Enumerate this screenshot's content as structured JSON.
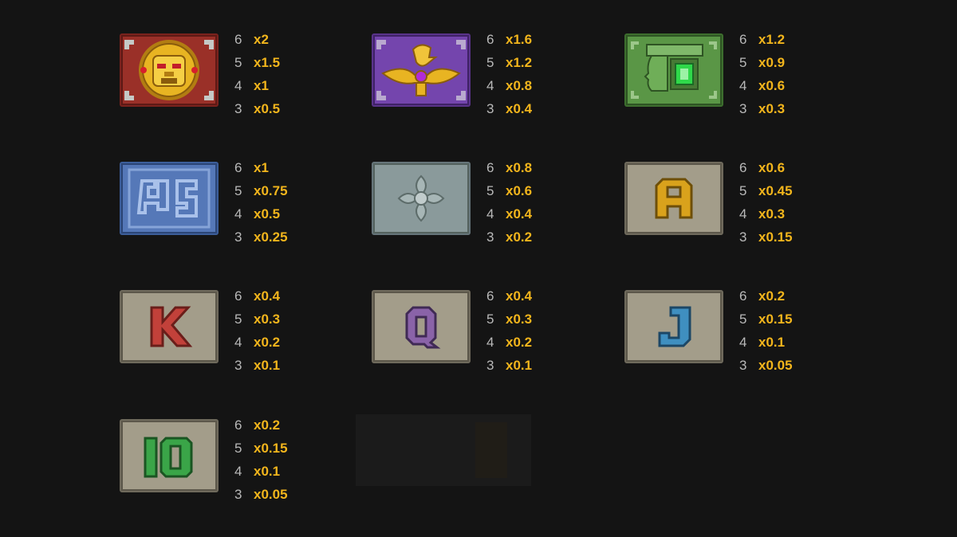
{
  "paytable": {
    "symbols": [
      {
        "name": "golden-sun-mask",
        "colors": {
          "bg": "#8e2a22",
          "accent": "#e8b422"
        },
        "pays": [
          {
            "count": "6",
            "mult": "x2"
          },
          {
            "count": "5",
            "mult": "x1.5"
          },
          {
            "count": "4",
            "mult": "x1"
          },
          {
            "count": "3",
            "mult": "x0.5"
          }
        ]
      },
      {
        "name": "golden-eagle",
        "colors": {
          "bg": "#6a3e9e",
          "accent": "#e8b422"
        },
        "pays": [
          {
            "count": "6",
            "mult": "x1.6"
          },
          {
            "count": "5",
            "mult": "x1.2"
          },
          {
            "count": "4",
            "mult": "x0.8"
          },
          {
            "count": "3",
            "mult": "x0.4"
          }
        ]
      },
      {
        "name": "jade-head",
        "colors": {
          "bg": "#4f8a3c",
          "accent": "#2fd84a"
        },
        "pays": [
          {
            "count": "6",
            "mult": "x1.2"
          },
          {
            "count": "5",
            "mult": "x0.9"
          },
          {
            "count": "4",
            "mult": "x0.6"
          },
          {
            "count": "3",
            "mult": "x0.3"
          }
        ]
      },
      {
        "name": "blue-glyph",
        "colors": {
          "bg": "#4c6fb0",
          "accent": "#9db8e6"
        },
        "pays": [
          {
            "count": "6",
            "mult": "x1"
          },
          {
            "count": "5",
            "mult": "x0.75"
          },
          {
            "count": "4",
            "mult": "x0.5"
          },
          {
            "count": "3",
            "mult": "x0.25"
          }
        ]
      },
      {
        "name": "stone-flower",
        "colors": {
          "bg": "#7d8c8d",
          "accent": "#b3bfbf"
        },
        "pays": [
          {
            "count": "6",
            "mult": "x0.8"
          },
          {
            "count": "5",
            "mult": "x0.6"
          },
          {
            "count": "4",
            "mult": "x0.4"
          },
          {
            "count": "3",
            "mult": "x0.2"
          }
        ]
      },
      {
        "name": "letter-a",
        "letter": "A",
        "colors": {
          "bg": "#8f8877",
          "accent": "#d9a21c"
        },
        "pays": [
          {
            "count": "6",
            "mult": "x0.6"
          },
          {
            "count": "5",
            "mult": "x0.45"
          },
          {
            "count": "4",
            "mult": "x0.3"
          },
          {
            "count": "3",
            "mult": "x0.15"
          }
        ]
      },
      {
        "name": "letter-k",
        "letter": "K",
        "colors": {
          "bg": "#8f8877",
          "accent": "#c2413a"
        },
        "pays": [
          {
            "count": "6",
            "mult": "x0.4"
          },
          {
            "count": "5",
            "mult": "x0.3"
          },
          {
            "count": "4",
            "mult": "x0.2"
          },
          {
            "count": "3",
            "mult": "x0.1"
          }
        ]
      },
      {
        "name": "letter-q",
        "letter": "Q",
        "colors": {
          "bg": "#8f8877",
          "accent": "#8a63a8"
        },
        "pays": [
          {
            "count": "6",
            "mult": "x0.4"
          },
          {
            "count": "5",
            "mult": "x0.3"
          },
          {
            "count": "4",
            "mult": "x0.2"
          },
          {
            "count": "3",
            "mult": "x0.1"
          }
        ]
      },
      {
        "name": "letter-j",
        "letter": "J",
        "colors": {
          "bg": "#8f8877",
          "accent": "#3f8fc0"
        },
        "pays": [
          {
            "count": "6",
            "mult": "x0.2"
          },
          {
            "count": "5",
            "mult": "x0.15"
          },
          {
            "count": "4",
            "mult": "x0.1"
          },
          {
            "count": "3",
            "mult": "x0.05"
          }
        ]
      },
      {
        "name": "number-10",
        "letter": "10",
        "colors": {
          "bg": "#8f8877",
          "accent": "#3aa548"
        },
        "pays": [
          {
            "count": "6",
            "mult": "x0.2"
          },
          {
            "count": "5",
            "mult": "x0.15"
          },
          {
            "count": "4",
            "mult": "x0.1"
          },
          {
            "count": "3",
            "mult": "x0.05"
          }
        ]
      }
    ]
  }
}
